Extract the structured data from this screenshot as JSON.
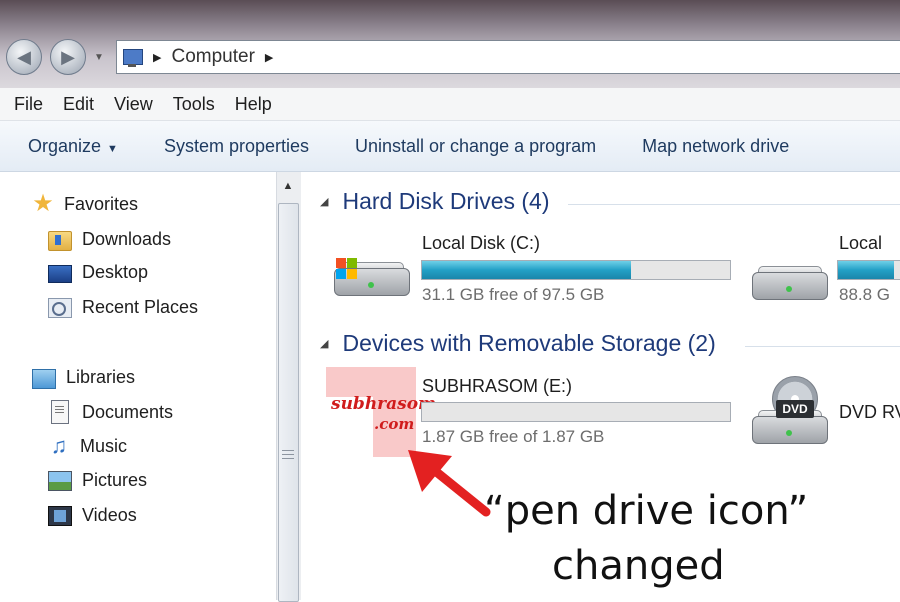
{
  "window": {
    "address": {
      "segments": [
        "Computer"
      ]
    }
  },
  "menubar": {
    "items": [
      "File",
      "Edit",
      "View",
      "Tools",
      "Help"
    ]
  },
  "commandbar": {
    "organize": "Organize",
    "system_properties": "System properties",
    "uninstall": "Uninstall or change a program",
    "map_drive": "Map network drive"
  },
  "navpane": {
    "favorites": {
      "label": "Favorites",
      "items": [
        "Downloads",
        "Desktop",
        "Recent Places"
      ]
    },
    "libraries": {
      "label": "Libraries",
      "items": [
        "Documents",
        "Music",
        "Pictures",
        "Videos"
      ]
    }
  },
  "content": {
    "hard_disks": {
      "heading": "Hard Disk Drives (4)",
      "drives": [
        {
          "name": "Local Disk (C:)",
          "free": "31.1 GB free of 97.5 GB",
          "used_fraction": 0.68
        },
        {
          "name": "Local",
          "free": "88.8 G",
          "used_fraction": 0.7
        }
      ]
    },
    "removable": {
      "heading": "Devices with Removable Storage (2)",
      "devices": [
        {
          "name": "SUBHRASOM (E:)",
          "free": "1.87 GB free of 1.87 GB",
          "used_fraction": 0.0,
          "icon_text_1": "subhrasom",
          "icon_text_2": ".com"
        },
        {
          "name": "DVD RV",
          "badge": "DVD"
        }
      ]
    }
  },
  "annotation": {
    "line1": "“pen drive icon”",
    "line2": "changed",
    "arrow_color": "#e32121"
  },
  "colors": {
    "accent_text": "#1e3a7a",
    "bar_fill": "#23a0c6"
  }
}
